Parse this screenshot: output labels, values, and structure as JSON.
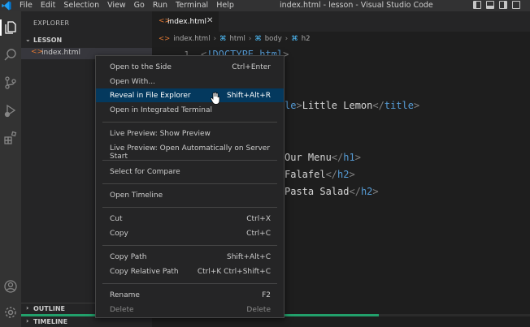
{
  "titlebar": {
    "menus": [
      "File",
      "Edit",
      "Selection",
      "View",
      "Go",
      "Run",
      "Terminal",
      "Help"
    ],
    "title": "index.html - lesson - Visual Studio Code"
  },
  "sidebar": {
    "title": "EXPLORER",
    "section": "LESSON",
    "file": "index.html",
    "outline": "OUTLINE",
    "timeline": "TIMELINE"
  },
  "editor": {
    "tab": "index.html",
    "breadcrumb": [
      "index.html",
      "html",
      "body",
      "h2"
    ],
    "line_number": "1",
    "lines": {
      "l1": {
        "open": "<",
        "tag": "!DOCTYPE html",
        "close": ">"
      },
      "l2": {
        "pre": "le",
        "text": "Little Lemon",
        "endtag": "title"
      },
      "l3": {
        "text": "Our Menu",
        "endtag": "h1"
      },
      "l4": {
        "text": "Falafel",
        "endtag": "h2"
      },
      "l5": {
        "text": "Pasta Salad",
        "endtag": "h2"
      }
    }
  },
  "context_menu": {
    "items": [
      {
        "label": "Open to the Side",
        "shortcut": "Ctrl+Enter"
      },
      {
        "label": "Open With...",
        "shortcut": ""
      },
      {
        "label": "Reveal in File Explorer",
        "shortcut": "Shift+Alt+R"
      },
      {
        "label": "Open in Integrated Terminal",
        "shortcut": ""
      },
      {
        "label": "Live Preview: Show Preview",
        "shortcut": ""
      },
      {
        "label": "Live Preview: Open Automatically on Server Start",
        "shortcut": ""
      },
      {
        "label": "Select for Compare",
        "shortcut": ""
      },
      {
        "label": "Open Timeline",
        "shortcut": ""
      },
      {
        "label": "Cut",
        "shortcut": "Ctrl+X"
      },
      {
        "label": "Copy",
        "shortcut": "Ctrl+C"
      },
      {
        "label": "Copy Path",
        "shortcut": "Shift+Alt+C"
      },
      {
        "label": "Copy Relative Path",
        "shortcut": "Ctrl+K Ctrl+Shift+C"
      },
      {
        "label": "Rename",
        "shortcut": "F2"
      },
      {
        "label": "Delete",
        "shortcut": "Delete"
      }
    ]
  },
  "colors": {
    "accent": "#04395e",
    "file_icon": "#e37933",
    "tag": "#569cd6"
  }
}
